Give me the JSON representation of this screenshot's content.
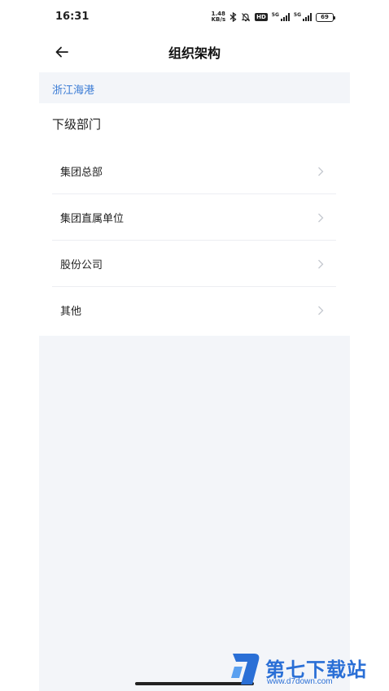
{
  "status_bar": {
    "time": "16:31",
    "net_speed_value": "1.48",
    "net_speed_unit": "KB/s",
    "hd_label": "HD",
    "sim1_label": "5G",
    "sim2_label": "5G",
    "battery_level": "69"
  },
  "header": {
    "title": "组织架构",
    "back_icon": "arrow-left-icon"
  },
  "breadcrumb": {
    "items": [
      "浙江海港"
    ]
  },
  "section": {
    "title": "下级部门"
  },
  "departments": [
    {
      "label": "集团总部"
    },
    {
      "label": "集团直属单位"
    },
    {
      "label": "股份公司"
    },
    {
      "label": "其他"
    }
  ],
  "colors": {
    "accent": "#3a7bd5",
    "band_background": "#f3f5f9",
    "divider": "#eceef2"
  },
  "watermark": {
    "title": "第七下载站",
    "url": "www.d7down.com"
  }
}
